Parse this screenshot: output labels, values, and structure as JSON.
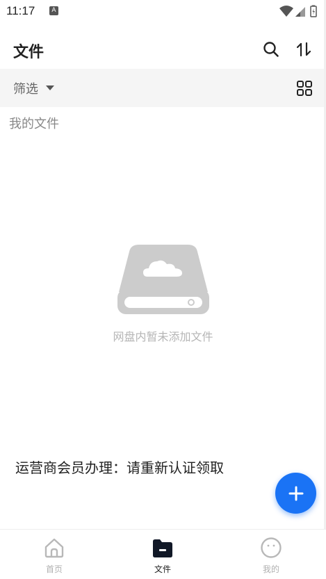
{
  "status_bar": {
    "time": "11:17",
    "notification_letter": "A"
  },
  "header": {
    "title": "文件",
    "icons": [
      "search-icon",
      "sort-icon"
    ]
  },
  "filter_bar": {
    "filter_label": "筛选",
    "view_icon": "grid-view-icon"
  },
  "content": {
    "section_title": "我的文件",
    "empty_text": "网盘内暂未添加文件",
    "promo_text": "运营商会员办理：请重新认证领取"
  },
  "fab": {
    "icon": "plus-icon",
    "color": "#1a73f5"
  },
  "bottom_nav": {
    "items": [
      {
        "label": "首页",
        "icon": "home-icon",
        "active": false
      },
      {
        "label": "文件",
        "icon": "folder-icon",
        "active": true
      },
      {
        "label": "我的",
        "icon": "profile-icon",
        "active": false
      }
    ]
  },
  "colors": {
    "accent": "#1a73f5",
    "text_primary": "#222222",
    "text_muted": "#b0b0b0",
    "filter_bg": "#f5f5f5"
  }
}
